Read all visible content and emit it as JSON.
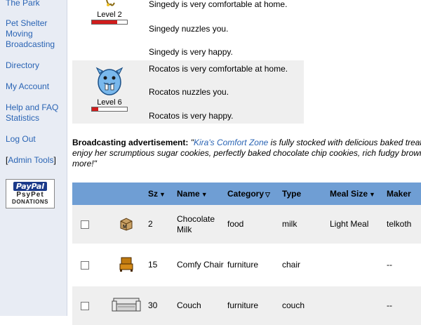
{
  "sidebar": {
    "links": [
      {
        "label": "The Park"
      },
      {
        "label": "Pet Shelter"
      },
      {
        "label": "Moving"
      },
      {
        "label": "Broadcasting"
      },
      {
        "label": "Directory"
      },
      {
        "label": "My Account"
      },
      {
        "label": "Help and FAQ"
      },
      {
        "label": "Statistics"
      },
      {
        "label": "Log Out"
      },
      {
        "label": "Admin Tools",
        "open": "[",
        "close": "]"
      }
    ],
    "donation": {
      "logo": "PayPal",
      "name": "PsyPet",
      "sub": "DONATIONS"
    }
  },
  "pets": [
    {
      "level": "Level 2",
      "level_fraction": 0.72,
      "messages": [
        "Singedy is very comfortable at home.",
        "Singedy nuzzles you.",
        "Singedy is very happy."
      ]
    },
    {
      "level": "Level 6",
      "level_fraction": 0.18,
      "messages": [
        "Rocatos is very comfortable at home.",
        "Rocatos nuzzles you.",
        "Rocatos is very happy."
      ]
    }
  ],
  "advertisement": {
    "label": "Broadcasting advertisement:",
    "quote_open": "\"",
    "link": "Kira's Comfort Zone",
    "line1": " is fully stocked with delicious baked treats",
    "line2": "enjoy her scrumptious sugar cookies, perfectly baked chocolate chip cookies, rich fudgy brownies",
    "line3": "more!\""
  },
  "table": {
    "headers": [
      {
        "label": ""
      },
      {
        "label": ""
      },
      {
        "label": "Sz",
        "sort": "▼"
      },
      {
        "label": "Name",
        "sort": "▼"
      },
      {
        "label": "Category",
        "sort": "▽"
      },
      {
        "label": "Type",
        "sort": ""
      },
      {
        "label": "Meal Size",
        "sort": "▼"
      },
      {
        "label": "Maker",
        "sort": ""
      }
    ],
    "rows": [
      {
        "icon": "box-icon",
        "size": "2",
        "name": "Chocolate Milk",
        "category": "food",
        "type": "milk",
        "meal_size": "Light Meal",
        "maker": "telkoth"
      },
      {
        "icon": "chair-icon",
        "size": "15",
        "name": "Comfy Chair",
        "category": "furniture",
        "type": "chair",
        "meal_size": "",
        "maker": "--"
      },
      {
        "icon": "couch-icon",
        "size": "30",
        "name": "Couch",
        "category": "furniture",
        "type": "couch",
        "meal_size": "",
        "maker": "--"
      }
    ]
  },
  "colors": {
    "link": "#2a64b4",
    "table_header": "#6f9ed4",
    "level_bar": "#d01c1c",
    "row_shade": "#efefef",
    "sidebar_bg": "#e8ecf4"
  }
}
